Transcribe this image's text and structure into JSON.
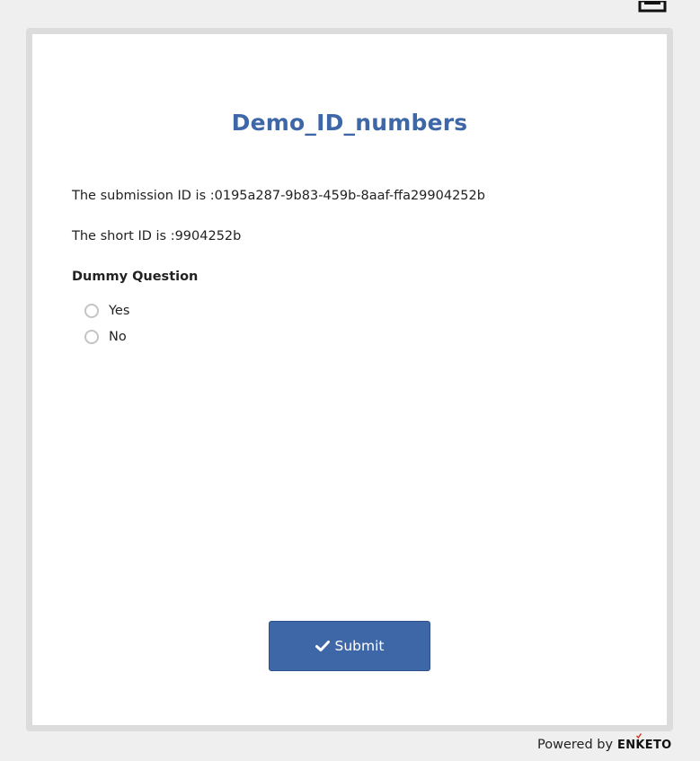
{
  "toolbar": {
    "print_icon": "print-icon"
  },
  "form": {
    "title": "Demo_ID_numbers",
    "submission_id_note": "The submission ID is :0195a287-9b83-459b-8aaf-ffa29904252b",
    "short_id_note": "The short ID is :9904252b",
    "question": {
      "label": "Dummy Question",
      "options": [
        {
          "label": "Yes",
          "selected": false
        },
        {
          "label": "No",
          "selected": false
        }
      ]
    },
    "submit_label": "Submit",
    "submit_icon": "check-icon"
  },
  "footer": {
    "powered_by": "Powered by",
    "brand": "ENKETO",
    "brand_accent_color": "#d0301e"
  },
  "colors": {
    "accent": "#3e67a8",
    "background": "#efefef",
    "frame_border": "#dcdcdc"
  }
}
